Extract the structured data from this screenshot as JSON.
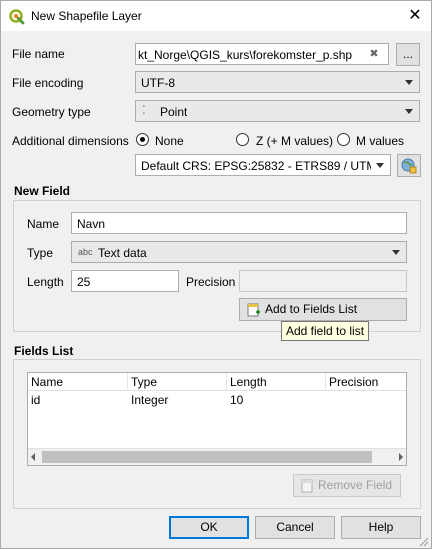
{
  "window": {
    "title": "New Shapefile Layer",
    "close_glyph": "✕"
  },
  "file": {
    "label": "File name",
    "value": "kt_Norge\\QGIS_kurs\\forekomster_p.shp",
    "clear_glyph": "✖",
    "browse_label": "..."
  },
  "encoding": {
    "label": "File encoding",
    "value": "UTF-8"
  },
  "geometry": {
    "label": "Geometry type",
    "value": "Point",
    "icon_glyph": "⁚"
  },
  "dimensions": {
    "label": "Additional dimensions",
    "options": [
      "None",
      "Z (+ M values)",
      "M values"
    ],
    "selected": "None"
  },
  "crs": {
    "value": "Default CRS: EPSG:25832 - ETRS89 / UTM"
  },
  "new_field": {
    "section": "New Field",
    "name_label": "Name",
    "name_value": "Navn",
    "type_label": "Type",
    "type_value": "Text data",
    "type_prefix": "abc",
    "length_label": "Length",
    "length_value": "25",
    "precision_label": "Precision",
    "precision_value": "",
    "add_button": "Add to Fields List",
    "tooltip": "Add field to list"
  },
  "fields_list": {
    "section": "Fields List",
    "columns": [
      "Name",
      "Type",
      "Length",
      "Precision"
    ],
    "rows": [
      {
        "name": "id",
        "type": "Integer",
        "length": "10",
        "precision": ""
      }
    ],
    "remove_button": "Remove Field"
  },
  "footer": {
    "ok": "OK",
    "cancel": "Cancel",
    "help": "Help"
  }
}
